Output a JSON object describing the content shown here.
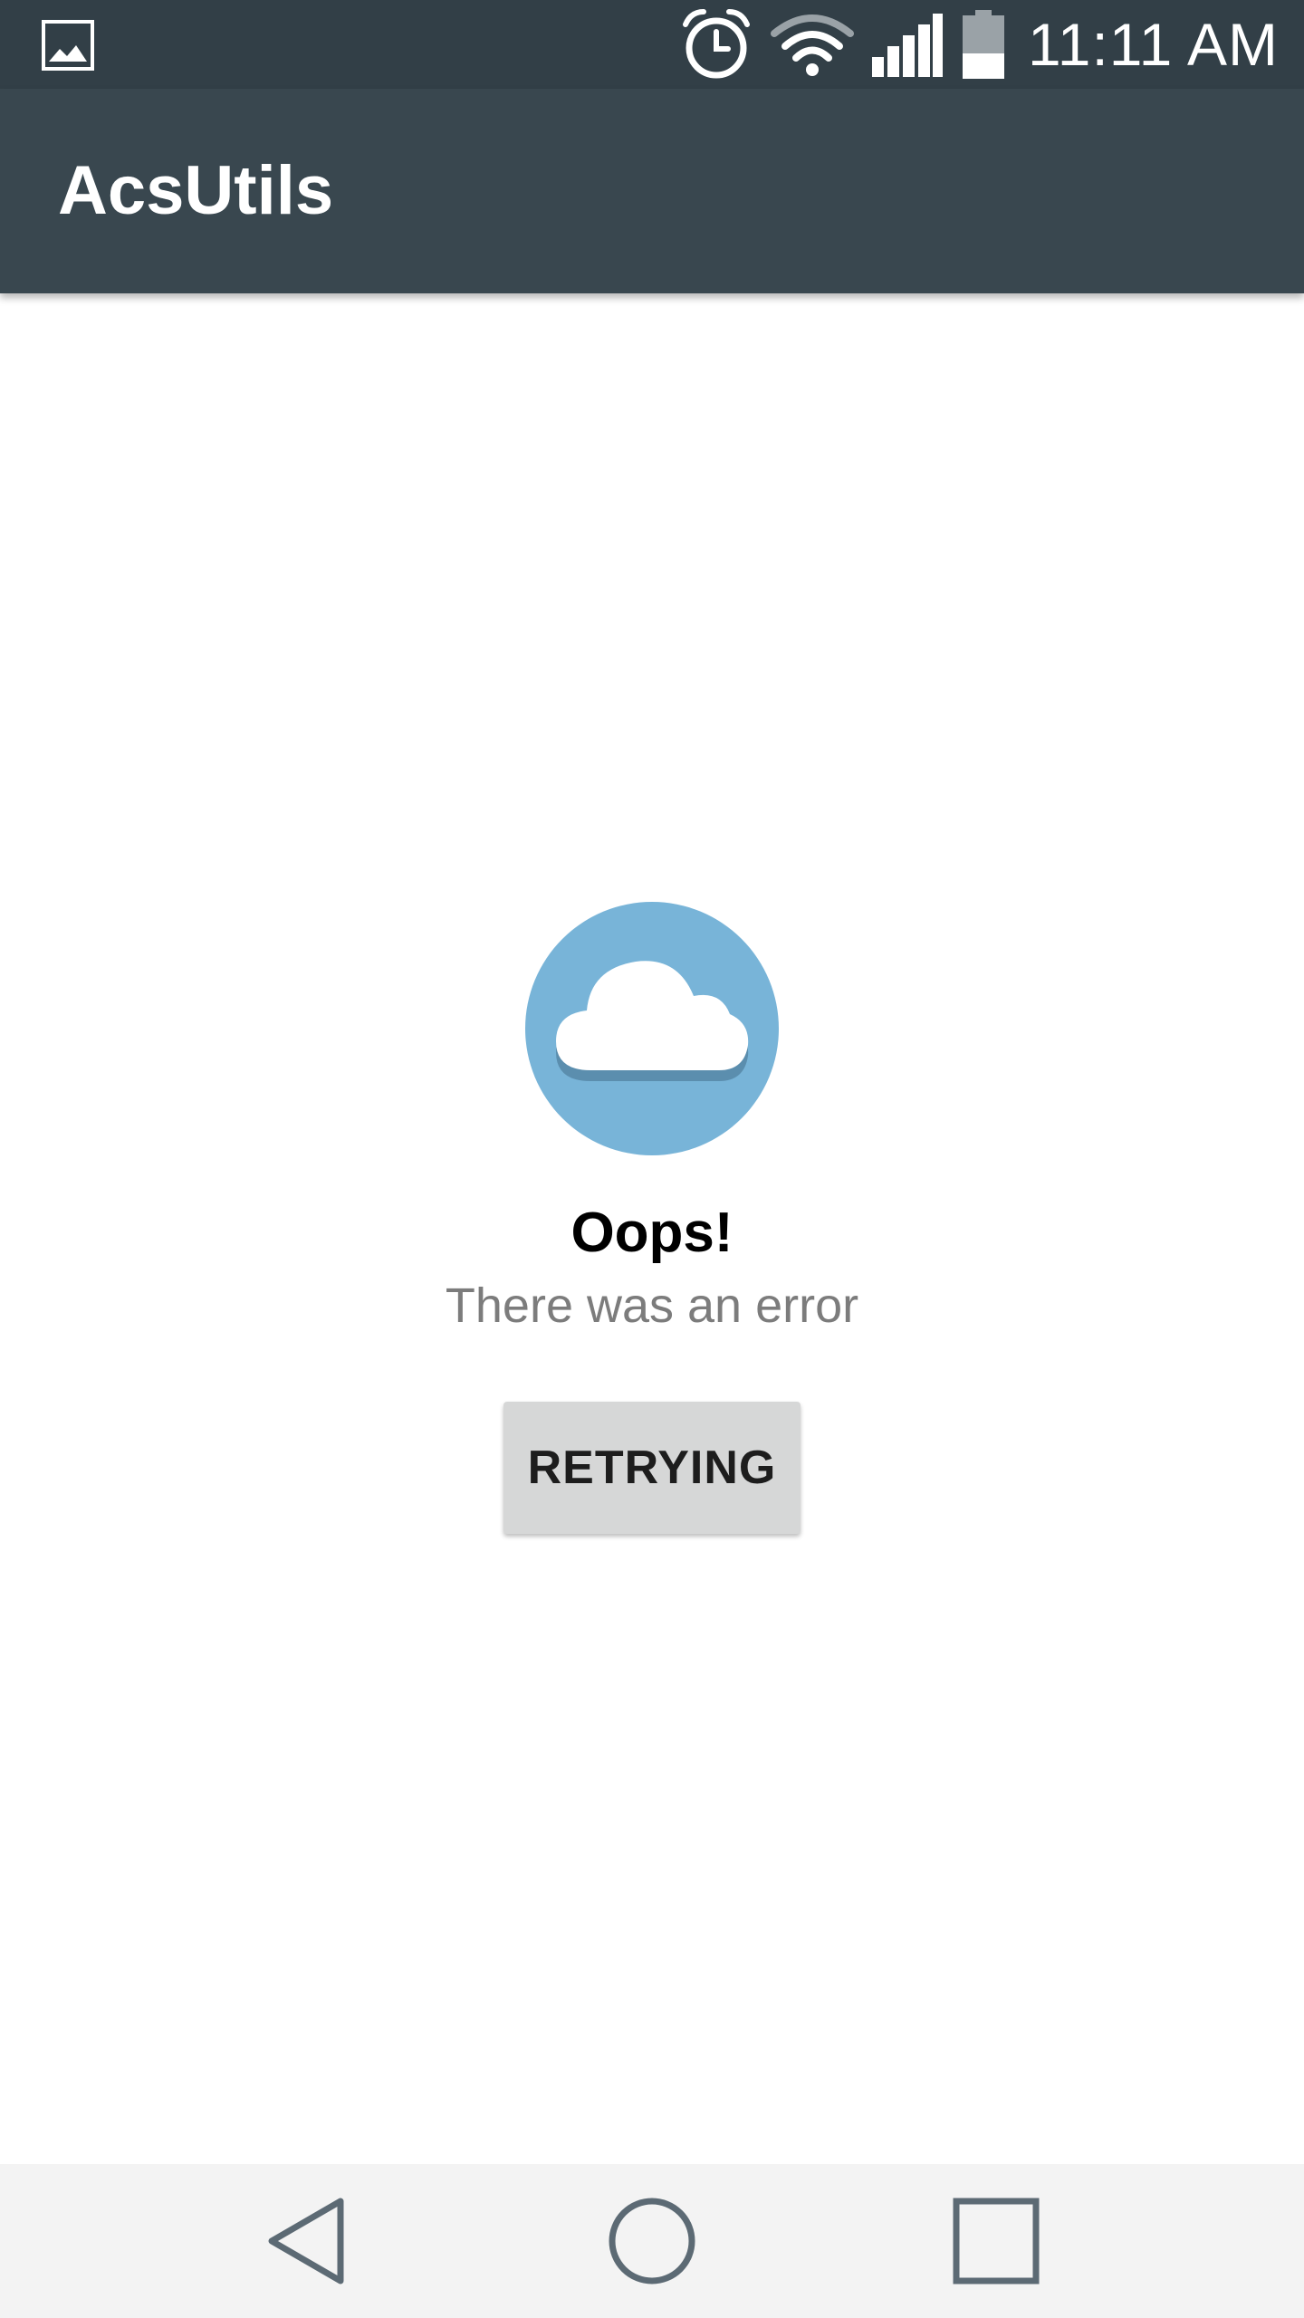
{
  "status_bar": {
    "time": "11:11 AM",
    "icons": [
      "image-notification-icon",
      "alarm-icon",
      "wifi-icon",
      "cell-signal-icon",
      "battery-icon"
    ],
    "battery_level_fraction": 0.4
  },
  "app_bar": {
    "title": "AcsUtils"
  },
  "error_state": {
    "icon": "cloud-icon",
    "title": "Oops!",
    "message": "There was an error",
    "button_label": "RETRYING"
  },
  "nav_bar": {
    "buttons": [
      "back-icon",
      "home-icon",
      "recent-apps-icon"
    ]
  },
  "colors": {
    "status_bar": "#323f47",
    "app_bar": "#39474f",
    "cloud_circle": "#78b4d8",
    "button_bg": "#d6d7d7",
    "nav_bar": "#f3f3f3",
    "nav_icon": "#5c6a74"
  }
}
